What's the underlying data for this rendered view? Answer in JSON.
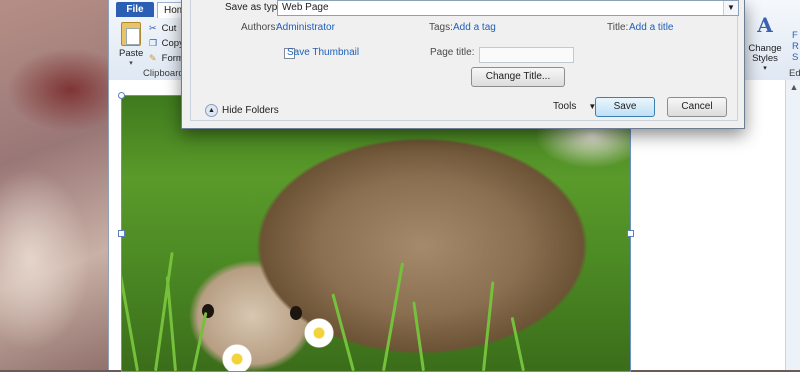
{
  "ribbon": {
    "file_tab": "File",
    "home_tab": "Hom",
    "paste": "Paste",
    "clipboard_items": [
      "Cut",
      "Copy",
      "Form"
    ],
    "clipboard_group": "Clipboard",
    "change_styles": "Change Styles",
    "edit_group": "Ed",
    "right_items": [
      "F",
      "R",
      "S"
    ]
  },
  "dialog": {
    "save_as_type_label": "Save as type:",
    "save_as_type_value": "Web Page",
    "authors_label": "Authors:",
    "authors_value": "Administrator",
    "tags_label": "Tags:",
    "tags_value": "Add a tag",
    "title_label": "Title:",
    "title_value": "Add a title",
    "save_thumbnail": "Save Thumbnail",
    "page_title_label": "Page title:",
    "page_title_value": "",
    "change_title": "Change Title...",
    "hide_folders": "Hide Folders",
    "tools": "Tools",
    "save": "Save",
    "cancel": "Cancel"
  },
  "colors": {
    "accent": "#2b5fb4",
    "link": "#1f5fb8"
  }
}
